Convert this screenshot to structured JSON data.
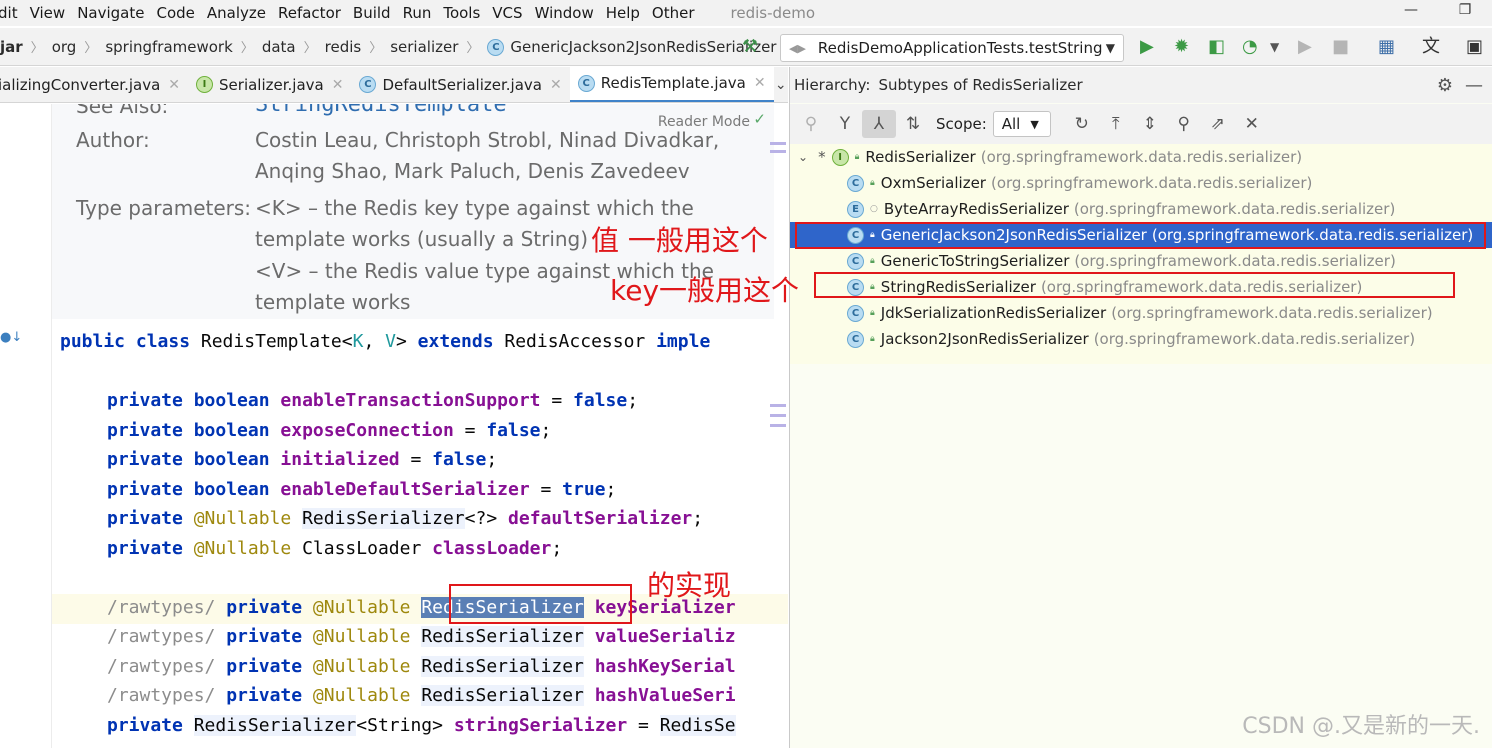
{
  "menu": {
    "items": [
      "dit",
      "View",
      "Navigate",
      "Code",
      "Analyze",
      "Refactor",
      "Build",
      "Run",
      "Tools",
      "VCS",
      "Window",
      "Help",
      "Other"
    ],
    "project_name": "redis-demo"
  },
  "breadcrumb": [
    "jar",
    "org",
    "springframework",
    "data",
    "redis",
    "serializer",
    "GenericJackson2JsonRedisSerializer"
  ],
  "run_config": "RedisDemoApplicationTests.testString",
  "editor_tabs": [
    {
      "label": "ializingConverter.java",
      "active": false
    },
    {
      "label": "Serializer.java",
      "active": false
    },
    {
      "label": "DefaultSerializer.java",
      "active": false
    },
    {
      "label": "RedisTemplate.java",
      "active": true
    }
  ],
  "doc": {
    "see_also_label": "See Also:",
    "see_also_value": "StringRedisTemplate",
    "reader_mode": "Reader Mode",
    "author_label": "Author:",
    "author_line1": "Costin Leau, Christoph Strobl, Ninad Divadkar,",
    "author_line2": "Anqing Shao, Mark Paluch, Denis Zavedeev",
    "type_params_label": "Type parameters:",
    "type_param_k_line1": "<K> – the Redis key type against which the",
    "type_param_k_line2": "template works (usually a String)",
    "type_param_v_line1": "<V> – the Redis value type against which the",
    "type_param_v_line2": "template works"
  },
  "hierarchy": {
    "title": "Hierarchy:",
    "subtitle": "Subtypes of RedisSerializer",
    "scope_label": "Scope:",
    "scope_value": "All",
    "root": {
      "name": "RedisSerializer",
      "package": "(org.springframework.data.redis.serializer)"
    },
    "children": [
      {
        "name": "OxmSerializer",
        "package": "(org.springframework.data.redis.serializer)",
        "kind": "C"
      },
      {
        "name": "ByteArrayRedisSerializer",
        "package": "(org.springframework.data.redis.serializer)",
        "kind": "E"
      },
      {
        "name": "GenericJackson2JsonRedisSerializer",
        "package": "(org.springframework.data.redis.serializer)",
        "kind": "C",
        "selected": true
      },
      {
        "name": "GenericToStringSerializer",
        "package": "(org.springframework.data.redis.serializer)",
        "kind": "C"
      },
      {
        "name": "StringRedisSerializer",
        "package": "(org.springframework.data.redis.serializer)",
        "kind": "C"
      },
      {
        "name": "JdkSerializationRedisSerializer",
        "package": "(org.springframework.data.redis.serializer)",
        "kind": "C"
      },
      {
        "name": "Jackson2JsonRedisSerializer",
        "package": "(org.springframework.data.redis.serializer)",
        "kind": "C"
      }
    ]
  },
  "annotations": {
    "value_note": "值 一般用这个",
    "key_note": "key一般用这个",
    "impl_note": "的实现"
  },
  "watermark": "CSDN @.又是新的一天."
}
